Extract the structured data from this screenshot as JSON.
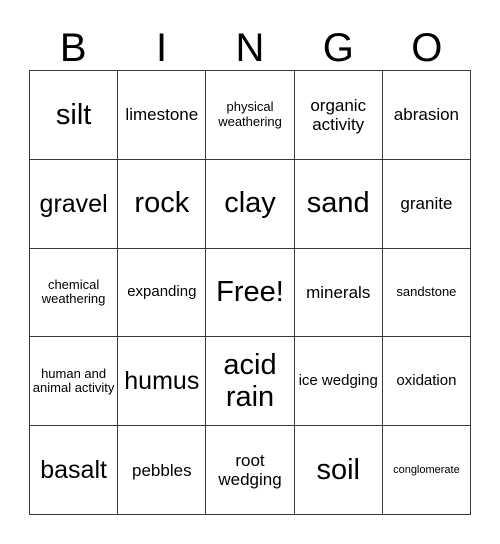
{
  "card": {
    "header_letters": [
      "B",
      "I",
      "N",
      "G",
      "O"
    ],
    "rows": [
      [
        {
          "text": "silt",
          "size": "fs-xl"
        },
        {
          "text": "limestone",
          "size": "fs-md"
        },
        {
          "text": "physical weathering",
          "size": "fs-xs"
        },
        {
          "text": "organic activity",
          "size": "fs-md"
        },
        {
          "text": "abrasion",
          "size": "fs-md"
        }
      ],
      [
        {
          "text": "gravel",
          "size": "fs-lg"
        },
        {
          "text": "rock",
          "size": "fs-xl"
        },
        {
          "text": "clay",
          "size": "fs-xl"
        },
        {
          "text": "sand",
          "size": "fs-xl"
        },
        {
          "text": "granite",
          "size": "fs-md"
        }
      ],
      [
        {
          "text": "chemical weathering",
          "size": "fs-xs"
        },
        {
          "text": "expanding",
          "size": "fs-sm"
        },
        {
          "text": "Free!",
          "size": "fs-xl"
        },
        {
          "text": "minerals",
          "size": "fs-md"
        },
        {
          "text": "sandstone",
          "size": "fs-xs"
        }
      ],
      [
        {
          "text": "human and animal activity",
          "size": "fs-xs"
        },
        {
          "text": "humus",
          "size": "fs-lg"
        },
        {
          "text": "acid rain",
          "size": "fs-xl"
        },
        {
          "text": "ice wedging",
          "size": "fs-sm"
        },
        {
          "text": "oxidation",
          "size": "fs-sm"
        }
      ],
      [
        {
          "text": "basalt",
          "size": "fs-lg"
        },
        {
          "text": "pebbles",
          "size": "fs-md"
        },
        {
          "text": "root wedging",
          "size": "fs-md"
        },
        {
          "text": "soil",
          "size": "fs-xl"
        },
        {
          "text": "conglomerate",
          "size": "fs-xxs"
        }
      ]
    ]
  }
}
